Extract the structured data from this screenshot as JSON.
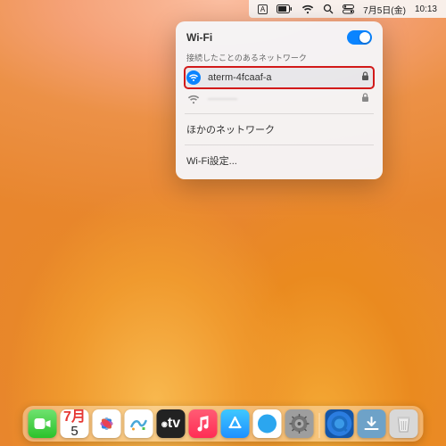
{
  "menubar": {
    "items": [
      "input-source",
      "battery",
      "wifi",
      "search",
      "control-center"
    ],
    "date": "7月5日(金)",
    "time": "10:13",
    "input_source_label": "A"
  },
  "wifi_panel": {
    "title": "Wi-Fi",
    "toggle_on": true,
    "known_label": "接続したことのあるネットワーク",
    "networks": [
      {
        "name": "aterm-4fcaaf-a",
        "connected": true,
        "secured": true,
        "highlighted": true
      },
      {
        "name": "———",
        "connected": false,
        "secured": true,
        "blurred": true
      }
    ],
    "other_label": "ほかのネットワーク",
    "settings_label": "Wi-Fi設定..."
  },
  "dock": {
    "calendar": {
      "month": "7月",
      "day": "5"
    },
    "tv_label": "tv",
    "apps": [
      "facetime",
      "calendar",
      "photos",
      "freeform",
      "tv",
      "music",
      "appstore",
      "safari",
      "settings",
      "|",
      "quicktime",
      "downloads",
      "trash"
    ]
  }
}
